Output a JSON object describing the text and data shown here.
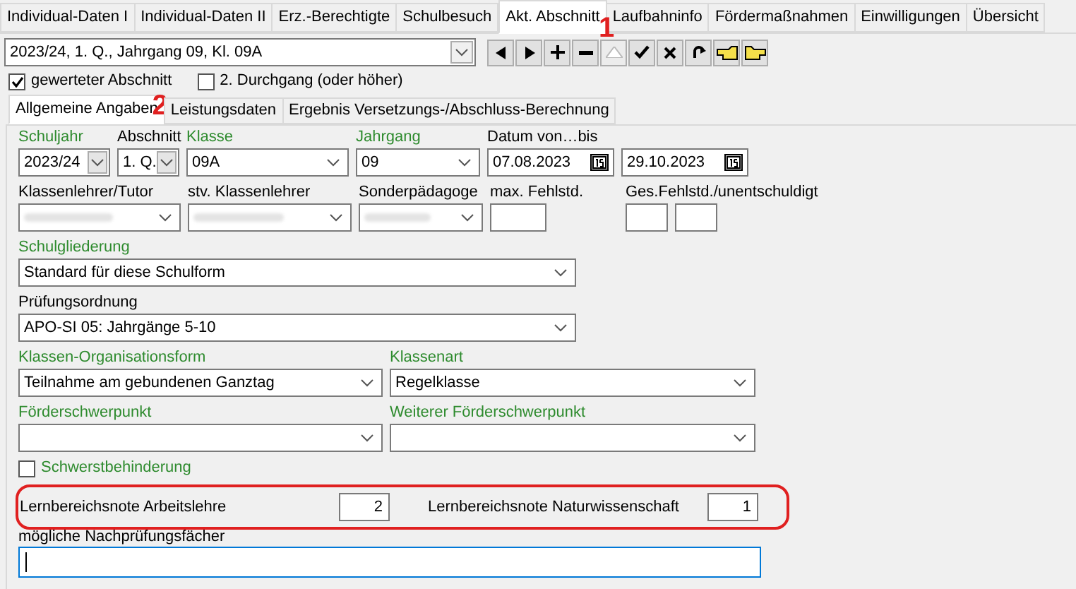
{
  "tabs": [
    {
      "label": "Individual-Daten I",
      "selected": false
    },
    {
      "label": "Individual-Daten II",
      "selected": false
    },
    {
      "label": "Erz.-Berechtigte",
      "selected": false
    },
    {
      "label": "Schulbesuch",
      "selected": false
    },
    {
      "label": "Akt. Abschnitt",
      "selected": true
    },
    {
      "label": "Laufbahninfo",
      "selected": false
    },
    {
      "label": "Fördermaßnahmen",
      "selected": false
    },
    {
      "label": "Einwilligungen",
      "selected": false
    },
    {
      "label": "Übersicht",
      "selected": false
    }
  ],
  "record_select": {
    "value": "2023/24, 1. Q., Jahrgang 09, Kl. 09A"
  },
  "nav_buttons": [
    {
      "kind": "prev",
      "disabled": false
    },
    {
      "kind": "next",
      "disabled": false
    },
    {
      "kind": "add",
      "disabled": false
    },
    {
      "kind": "remove",
      "disabled": false
    },
    {
      "kind": "up",
      "disabled": true
    },
    {
      "kind": "confirm",
      "disabled": false
    },
    {
      "kind": "cancel",
      "disabled": false
    },
    {
      "kind": "refresh",
      "disabled": false
    },
    {
      "kind": "hand_left",
      "disabled": false
    },
    {
      "kind": "hand_right",
      "disabled": false
    }
  ],
  "annotations": [
    {
      "label": "1"
    },
    {
      "label": "2"
    }
  ],
  "options": [
    {
      "label": "gewerteter Abschnitt",
      "checked": true
    },
    {
      "label": "2. Durchgang (oder höher)",
      "checked": false
    }
  ],
  "subtabs": [
    {
      "label": "Allgemeine Angaben",
      "selected": true
    },
    {
      "label": "Leistungsdaten",
      "selected": false
    },
    {
      "label": "Ergebnis Versetzungs-/Abschluss-Berechnung",
      "selected": false
    }
  ],
  "form_rows": [
    [
      {
        "label": "Schuljahr",
        "kind": "spin_select",
        "value": "2023/24",
        "required": true
      },
      {
        "label": "Abschnitt",
        "kind": "spin_select",
        "value": "1. Q.",
        "required": false
      },
      {
        "label": "Klasse",
        "kind": "select",
        "value": "09A",
        "required": true
      },
      {
        "label": "Jahrgang",
        "kind": "select",
        "value": "09",
        "required": true
      },
      {
        "label": "Datum von…bis",
        "kind": "date_range",
        "values": [
          "07.08.2023",
          "29.10.2023"
        ],
        "required": false
      }
    ],
    [
      {
        "label": "Klassenlehrer/Tutor",
        "kind": "select",
        "redacted": true,
        "required": false
      },
      {
        "label": "stv. Klassenlehrer",
        "kind": "select",
        "redacted": true,
        "required": false
      },
      {
        "label": "Sonderpädagoge",
        "kind": "select",
        "redacted": true,
        "required": false
      },
      {
        "label": "max. Fehlstd.",
        "kind": "input",
        "required": false
      },
      {
        "label": "Ges.Fehlstd./unentschuldigt",
        "kind": "input_pair",
        "required": false
      }
    ],
    [
      {
        "label": "Schulgliederung",
        "kind": "select",
        "value": "Standard für diese Schulform",
        "required": true
      }
    ],
    [
      {
        "label": "Prüfungsordnung",
        "kind": "select",
        "value": "APO-SI 05: Jahrgänge 5-10",
        "required": false
      }
    ],
    [
      {
        "label": "Klassen-Organisationsform",
        "kind": "select",
        "value": "Teilnahme am gebundenen Ganztag",
        "required": true
      },
      {
        "label": "Klassenart",
        "kind": "select",
        "value": "Regelklasse",
        "required": true
      }
    ],
    [
      {
        "label": "Förderschwerpunkt",
        "kind": "select",
        "required": true
      },
      {
        "label": "Weiterer Förderschwerpunkt",
        "kind": "select",
        "required": true
      }
    ]
  ],
  "severe_disability": {
    "label": "Schwerstbehinderung",
    "checked": false,
    "required": true
  },
  "grades": {
    "highlighted": true,
    "items": [
      {
        "label": "Lernbereichsnote Arbeitslehre",
        "value": "2"
      },
      {
        "label": "Lernbereichsnote Naturwissenschaft",
        "value": "1"
      }
    ]
  },
  "retest": {
    "label": "mögliche Nachprüfungsfächer",
    "focused": true
  }
}
